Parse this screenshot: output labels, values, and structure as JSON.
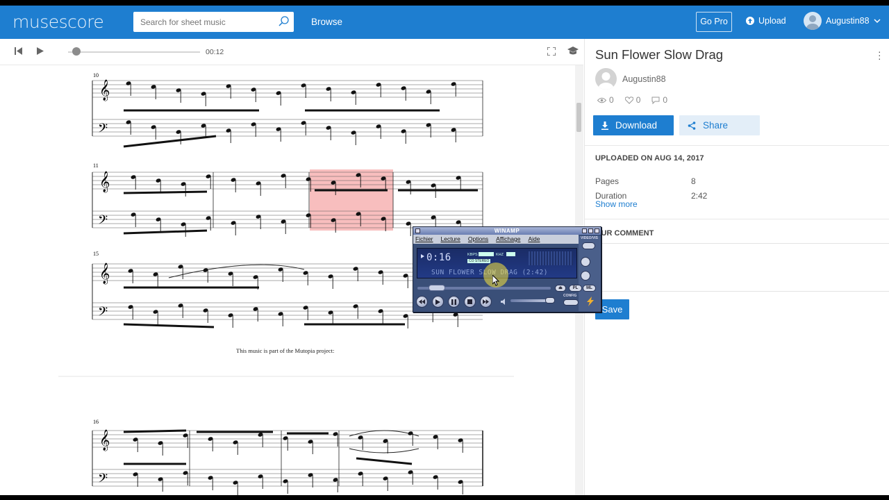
{
  "header": {
    "logo": "musescore",
    "search_placeholder": "Search for sheet music",
    "browse": "Browse",
    "gopro": "Go Pro",
    "upload": "Upload",
    "username": "Augustin88"
  },
  "player": {
    "time": "00:12",
    "progress": 0.05
  },
  "score": {
    "measures": [
      "10",
      "11",
      "15",
      "16"
    ],
    "footer": "This music is part of the Mutopia project:"
  },
  "sidebar": {
    "title": "Sun Flower Slow Drag",
    "author": "Augustin88",
    "views": "0",
    "likes": "0",
    "comments": "0",
    "download": "Download",
    "share": "Share",
    "uploaded": "UPLOADED ON AUG 14, 2017",
    "meta": [
      {
        "label": "Pages",
        "value": "8"
      },
      {
        "label": "Duration",
        "value": "2:42"
      }
    ],
    "show_more": "Show more",
    "comment_heading": "OUR COMMENT",
    "save": "Save"
  },
  "winamp": {
    "title": "WINAMP",
    "menu": [
      "Fichier",
      "Lecture",
      "Options",
      "Affichage",
      "Aide"
    ],
    "time": "0:16",
    "song": "SUN FLOWER SLOW DRAG (2:42)",
    "kbps_label": "KBPS",
    "khz_label": "KHZ",
    "stereo": "CO STEREO",
    "pl": "PL",
    "ml": "ML",
    "config": "CONFIG",
    "video": "VIDEO/VIS"
  },
  "colors": {
    "brand": "#1e7ed0",
    "highlight": "#f7b7b7"
  }
}
